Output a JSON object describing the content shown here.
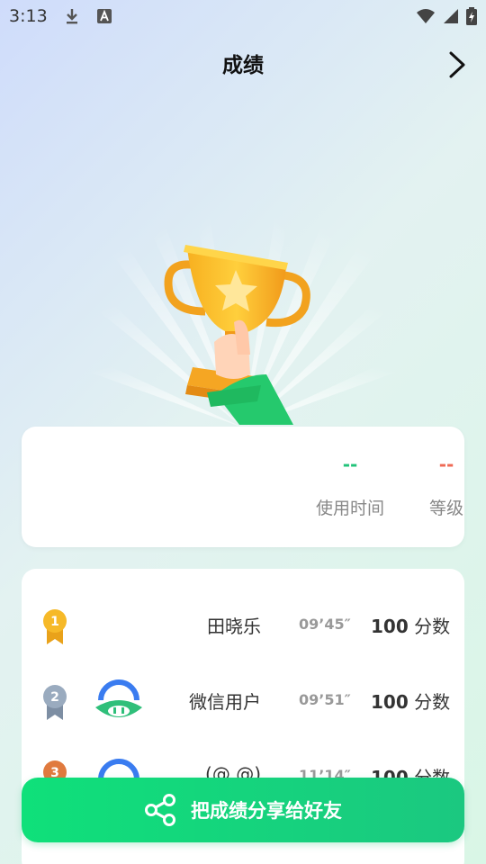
{
  "status_bar": {
    "time": "3:13"
  },
  "header": {
    "title": "成绩"
  },
  "stats": {
    "time_value": "--",
    "time_label": "使用时间",
    "level_value": "--",
    "level_label": "等级"
  },
  "ranking": [
    {
      "rank": "1",
      "name": "田晓乐",
      "time": "09’45″",
      "score_value": "100",
      "score_unit": "分数"
    },
    {
      "rank": "2",
      "name": "微信用户",
      "time": "09’51″",
      "score_value": "100",
      "score_unit": "分数"
    },
    {
      "rank": "3",
      "name": "(@.@)",
      "time": "11’14″",
      "score_value": "100",
      "score_unit": "分数"
    }
  ],
  "share_button": {
    "label": "把成绩分享给好友"
  },
  "colors": {
    "accent_green": "#1bc880",
    "level_red": "#ef6a55",
    "gold": "#f6b928"
  }
}
